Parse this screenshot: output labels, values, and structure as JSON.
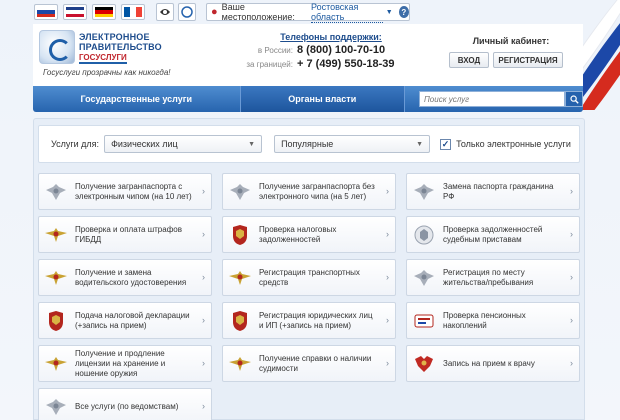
{
  "colors": {
    "accent": "#2764ae",
    "brand_red": "#c0262d",
    "link": "#1d5aa0"
  },
  "lang_flags": [
    {
      "name": "ru-flag-icon",
      "colors": [
        "#ffffff",
        "#1c48a8",
        "#d52b1e"
      ],
      "layout": "horizontal"
    },
    {
      "name": "uk-flag-icon",
      "colors": [
        "#1e3f8a",
        "#ffffff",
        "#c8102e"
      ],
      "layout": "horizontal"
    },
    {
      "name": "de-flag-icon",
      "colors": [
        "#000000",
        "#dd0000",
        "#ffce00"
      ],
      "layout": "horizontal"
    },
    {
      "name": "fr-flag-icon",
      "colors": [
        "#0055a4",
        "#ffffff",
        "#ef4135"
      ],
      "layout": "vertical"
    }
  ],
  "location": {
    "label": "Ваше местоположение:",
    "region": "Ростовская область",
    "help": "?"
  },
  "header": {
    "logo_line1": "ЭЛЕКТРОННОЕ",
    "logo_line2": "ПРАВИТЕЛЬСТВО",
    "logo_gos": "ГОСУСЛУГИ",
    "slogan": "Госуслуги прозрачны как никогда!",
    "support_title": "Телефоны поддержки:",
    "phones": [
      {
        "label": "в России:",
        "number": "8 (800) 100-70-10"
      },
      {
        "label": "за границей:",
        "number": "+ 7 (499) 550-18-39"
      }
    ],
    "cabinet_title": "Личный кабинет:",
    "login_label": "ВХОД",
    "register_label": "РЕГИСТРАЦИЯ"
  },
  "nav": {
    "services_label": "Государственные услуги",
    "authorities_label": "Органы власти",
    "search_placeholder": "Поиск услуг"
  },
  "filter": {
    "label": "Услуги для:",
    "audience_value": "Физических лиц",
    "sort_value": "Популярные",
    "electronic_only_label": "Только электронные услуги",
    "electronic_only_checked": true
  },
  "services": [
    {
      "label": "Получение загранпаспорта с электронным чипом (на 10 лет)",
      "icon": "emblem-grey-icon"
    },
    {
      "label": "Получение загранпаспорта без электронного чипа (на 5 лет)",
      "icon": "emblem-grey-icon"
    },
    {
      "label": "Замена паспорта гражданина РФ",
      "icon": "emblem-grey-icon"
    },
    {
      "label": "Проверка и оплата штрафов ГИБДД",
      "icon": "police-emblem-icon"
    },
    {
      "label": "Проверка налоговых задолженностей",
      "icon": "tax-emblem-icon"
    },
    {
      "label": "Проверка задолженностей судебным приставам",
      "icon": "bailiff-emblem-icon"
    },
    {
      "label": "Получение и замена водительского удостоверения",
      "icon": "police-emblem-icon"
    },
    {
      "label": "Регистрация транспортных средств",
      "icon": "police-emblem-icon"
    },
    {
      "label": "Регистрация по месту жительства/пребывания",
      "icon": "emblem-grey-icon"
    },
    {
      "label": "Подача налоговой декларации (+запись на прием)",
      "icon": "tax-emblem-icon"
    },
    {
      "label": "Регистрация юридических лиц и ИП (+запись на прием)",
      "icon": "tax-emblem-icon"
    },
    {
      "label": "Проверка пенсионных накоплений",
      "icon": "pension-fund-icon"
    },
    {
      "label": "Получение и продление лицензии на хранение и ношение оружия",
      "icon": "police-emblem-icon"
    },
    {
      "label": "Получение справки о наличии судимости",
      "icon": "police-emblem-icon"
    },
    {
      "label": "Запись на прием к врачу",
      "icon": "coat-of-arms-icon"
    },
    {
      "label": "Все услуги (по ведомствам)",
      "icon": "emblem-grey-icon"
    }
  ]
}
